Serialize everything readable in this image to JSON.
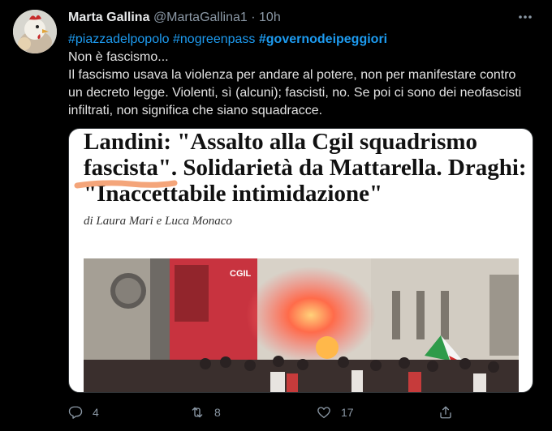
{
  "tweet": {
    "author_name": "Marta Gallina",
    "handle": "@MartaGallina1",
    "separator": "·",
    "time": "10h",
    "hashtags": [
      "#piazzadelpopolo",
      "#nogreenpass",
      "#governodeipeggiori"
    ],
    "lines": [
      "Non è fascismo...",
      "Il fascismo usava la violenza per andare al potere, non per manifestare contro un decreto legge. Violenti, sì (alcuni); fascisti, no. Se poi ci sono dei neofascisti infiltrati, non significa che siano squadracce."
    ]
  },
  "article": {
    "headline_line1": "Landini: \"Assalto alla Cgil squadrismo",
    "headline_line2": "fascista\". Solidarietà da Mattarella. Draghi:",
    "headline_line3": "\"Inaccettabile intimidazione\"",
    "byline": "di Laura Mari e Luca Monaco",
    "photo_sign": "CGIL"
  },
  "actions": {
    "replies": "4",
    "retweets": "8",
    "likes": "17"
  },
  "colors": {
    "background": "#000000",
    "link": "#1d9bf0",
    "muted": "#8b98a5",
    "highlight": "#f4a57a"
  },
  "icons": [
    "more-icon",
    "reply-icon",
    "retweet-icon",
    "like-icon",
    "share-icon"
  ]
}
